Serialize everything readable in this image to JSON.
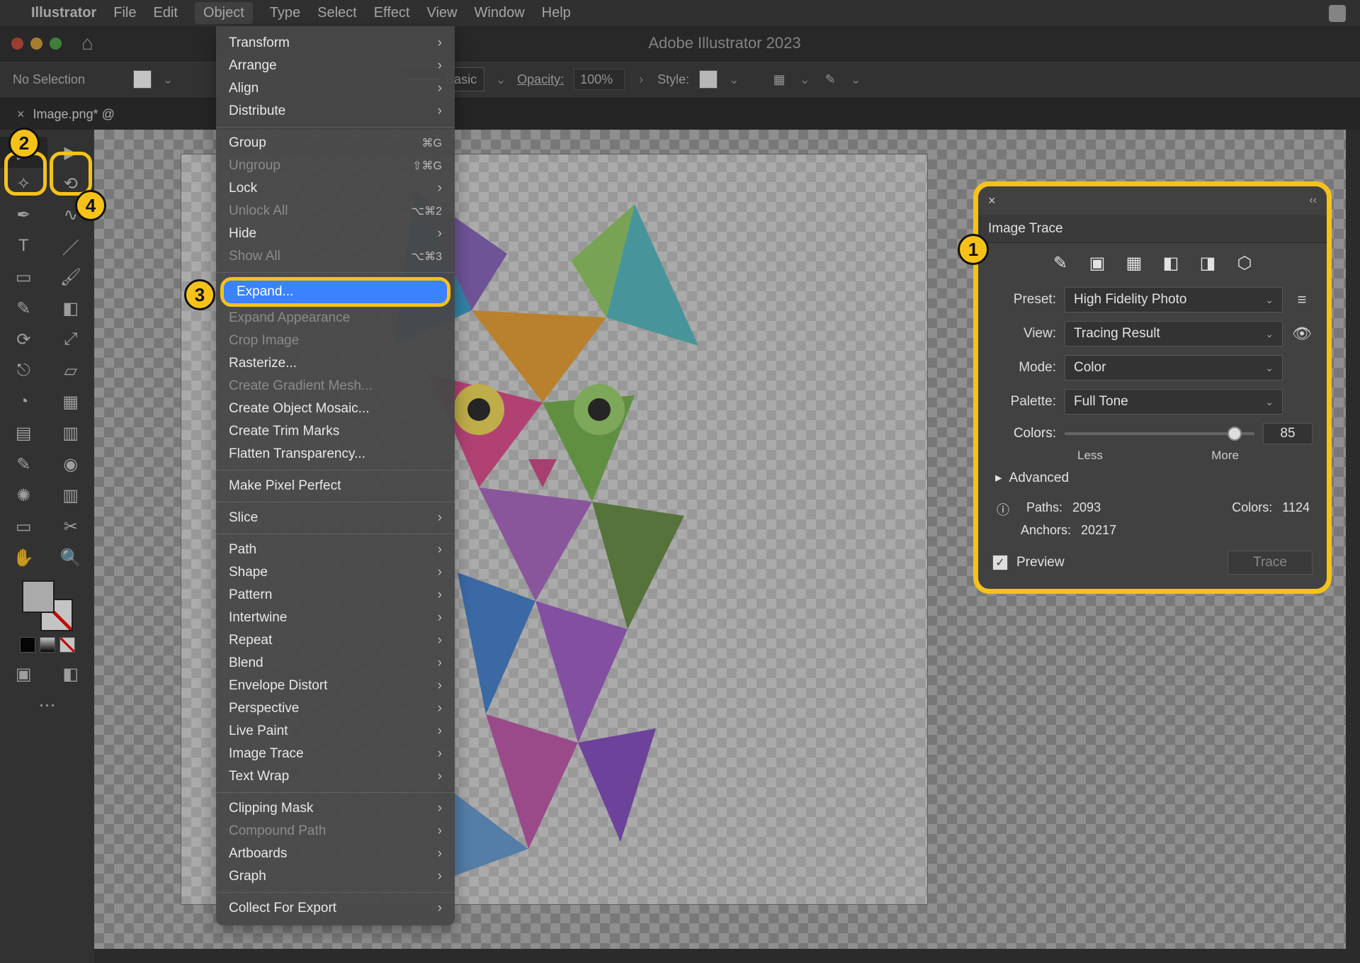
{
  "menubar": {
    "app": "Illustrator",
    "items": [
      "File",
      "Edit",
      "Object",
      "Type",
      "Select",
      "Effect",
      "View",
      "Window",
      "Help"
    ],
    "active_index": 2
  },
  "window": {
    "title": "Adobe Illustrator 2023"
  },
  "control_bar": {
    "selection": "No Selection",
    "stroke_style": "Basic",
    "opacity_label": "Opacity:",
    "opacity_value": "100%",
    "style_label": "Style:"
  },
  "tab": {
    "name": "Image.png* @"
  },
  "dropdown": {
    "items": [
      {
        "label": "Transform",
        "arrow": true
      },
      {
        "label": "Arrange",
        "arrow": true
      },
      {
        "label": "Align",
        "arrow": true
      },
      {
        "label": "Distribute",
        "arrow": true
      },
      {
        "sep": true
      },
      {
        "label": "Group",
        "shortcut": "⌘G"
      },
      {
        "label": "Ungroup",
        "shortcut": "⇧⌘G",
        "disabled": true
      },
      {
        "label": "Lock",
        "arrow": true
      },
      {
        "label": "Unlock All",
        "shortcut": "⌥⌘2",
        "disabled": true
      },
      {
        "label": "Hide",
        "arrow": true
      },
      {
        "label": "Show All",
        "shortcut": "⌥⌘3",
        "disabled": true
      },
      {
        "sep": true
      },
      {
        "label": "Expand...",
        "highlight": true
      },
      {
        "label": "Expand Appearance",
        "disabled": true
      },
      {
        "label": "Crop Image",
        "disabled": true
      },
      {
        "label": "Rasterize..."
      },
      {
        "label": "Create Gradient Mesh...",
        "disabled": true
      },
      {
        "label": "Create Object Mosaic..."
      },
      {
        "label": "Create Trim Marks"
      },
      {
        "label": "Flatten Transparency..."
      },
      {
        "sep": true
      },
      {
        "label": "Make Pixel Perfect"
      },
      {
        "sep": true
      },
      {
        "label": "Slice",
        "arrow": true
      },
      {
        "sep": true
      },
      {
        "label": "Path",
        "arrow": true
      },
      {
        "label": "Shape",
        "arrow": true
      },
      {
        "label": "Pattern",
        "arrow": true
      },
      {
        "label": "Intertwine",
        "arrow": true
      },
      {
        "label": "Repeat",
        "arrow": true
      },
      {
        "label": "Blend",
        "arrow": true
      },
      {
        "label": "Envelope Distort",
        "arrow": true
      },
      {
        "label": "Perspective",
        "arrow": true
      },
      {
        "label": "Live Paint",
        "arrow": true
      },
      {
        "label": "Image Trace",
        "arrow": true
      },
      {
        "label": "Text Wrap",
        "arrow": true
      },
      {
        "sep": true
      },
      {
        "label": "Clipping Mask",
        "arrow": true
      },
      {
        "label": "Compound Path",
        "arrow": true,
        "disabled": true
      },
      {
        "label": "Artboards",
        "arrow": true
      },
      {
        "label": "Graph",
        "arrow": true
      },
      {
        "sep": true
      },
      {
        "label": "Collect For Export",
        "arrow": true
      }
    ]
  },
  "image_trace": {
    "title": "Image Trace",
    "preset_label": "Preset:",
    "preset_value": "High Fidelity Photo",
    "view_label": "View:",
    "view_value": "Tracing Result",
    "mode_label": "Mode:",
    "mode_value": "Color",
    "palette_label": "Palette:",
    "palette_value": "Full Tone",
    "colors_label": "Colors:",
    "colors_value": "85",
    "less": "Less",
    "more": "More",
    "advanced": "Advanced",
    "paths_label": "Paths:",
    "paths_value": "2093",
    "colors_count_label": "Colors:",
    "colors_count_value": "1124",
    "anchors_label": "Anchors:",
    "anchors_value": "20217",
    "preview_label": "Preview",
    "trace_label": "Trace"
  },
  "callouts": {
    "c1": "1",
    "c2": "2",
    "c3": "3",
    "c4": "4"
  }
}
